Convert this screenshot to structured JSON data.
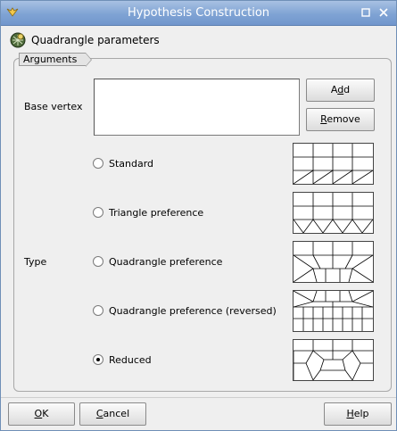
{
  "window": {
    "title": "Hypothesis Construction"
  },
  "header": {
    "label": "Quadrangle parameters",
    "icon": "mesh-hypothesis-icon"
  },
  "group": {
    "label": "Arguments"
  },
  "base_vertex": {
    "label": "Base vertex",
    "add_prefix": "A",
    "add_underline": "d",
    "add_suffix": "d",
    "remove_prefix": "",
    "remove_underline": "R",
    "remove_suffix": "emove"
  },
  "type": {
    "label": "Type",
    "options": [
      {
        "label": "Standard",
        "checked": false
      },
      {
        "label": "Triangle preference",
        "checked": false
      },
      {
        "label": "Quadrangle preference",
        "checked": false
      },
      {
        "label": "Quadrangle preference (reversed)",
        "checked": false
      },
      {
        "label": "Reduced",
        "checked": true
      }
    ]
  },
  "footer": {
    "ok_underline": "O",
    "ok_rest": "K",
    "cancel_underline": "C",
    "cancel_rest": "ancel",
    "help_underline": "H",
    "help_rest": "elp"
  }
}
